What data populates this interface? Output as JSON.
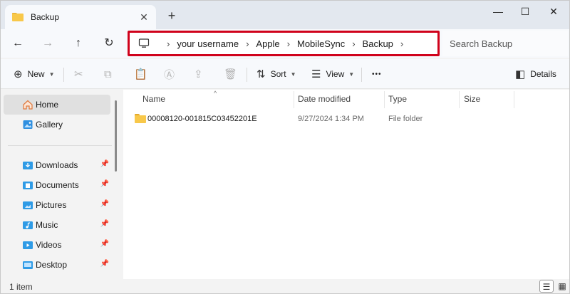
{
  "tab": {
    "title": "Backup",
    "close_glyph": "✕",
    "new_tab_glyph": "+"
  },
  "window_controls": {
    "minimize": "—",
    "maximize": "☐",
    "close": "✕"
  },
  "nav": {
    "back": "←",
    "forward": "→",
    "up": "↑",
    "refresh": "↻"
  },
  "address": {
    "crumbs": [
      "your username",
      "Apple",
      "MobileSync",
      "Backup"
    ],
    "separator": "›",
    "highlight_color": "#d0021b"
  },
  "search": {
    "placeholder": "Search Backup"
  },
  "toolbar": {
    "new_label": "New",
    "sort_label": "Sort",
    "view_label": "View",
    "more_glyph": "•••",
    "details_label": "Details",
    "icons": {
      "new": "⊕",
      "cut": "✂",
      "copy": "⧉",
      "paste": "📋",
      "rename": "Ⓐ",
      "share": "⇪",
      "delete": "🗑",
      "sort": "⇅",
      "view": "☰",
      "details": "◧",
      "chevron": "▼"
    }
  },
  "sidebar": {
    "items": [
      {
        "label": "Home",
        "icon": "home-icon"
      },
      {
        "label": "Gallery",
        "icon": "gallery-icon"
      },
      {
        "label": "Downloads",
        "icon": "downloads-icon",
        "pinned": true
      },
      {
        "label": "Documents",
        "icon": "documents-icon",
        "pinned": true
      },
      {
        "label": "Pictures",
        "icon": "pictures-icon",
        "pinned": true
      },
      {
        "label": "Music",
        "icon": "music-icon",
        "pinned": true
      },
      {
        "label": "Videos",
        "icon": "videos-icon",
        "pinned": true
      },
      {
        "label": "Desktop",
        "icon": "desktop-icon",
        "pinned": true
      }
    ],
    "pin_glyph": "📌"
  },
  "table": {
    "columns": [
      "Name",
      "Date modified",
      "Type",
      "Size"
    ],
    "sort_caret": "^",
    "rows": [
      {
        "name": "00008120-001815C03452201E",
        "date": "9/27/2024 1:34 PM",
        "type": "File folder",
        "size": ""
      }
    ]
  },
  "status": {
    "item_count": "1 item",
    "details_view_glyph": "☰",
    "tiles_view_glyph": "▦"
  }
}
